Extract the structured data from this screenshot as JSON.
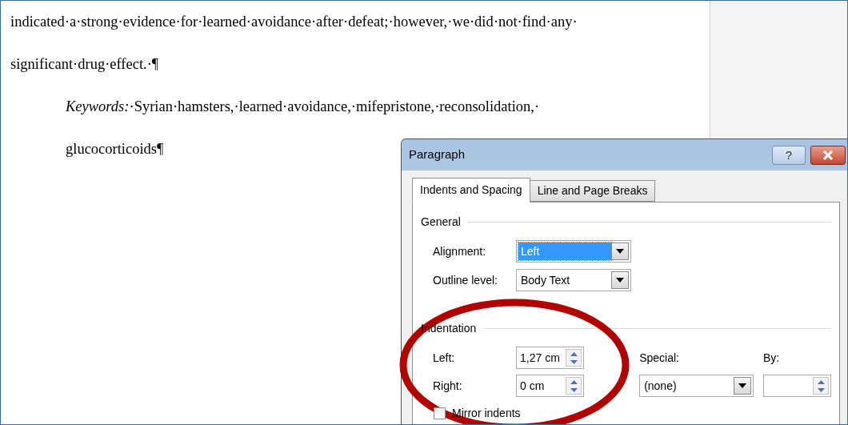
{
  "document": {
    "lines": [
      {
        "kind": "body",
        "text": "indicated·a·strong·evidence·for·learned·avoidance·after·defeat;·however,·we·did·not·find·any·"
      },
      {
        "kind": "body",
        "text": "significant·drug·effect.·¶"
      },
      {
        "kind": "indented",
        "text": "*Keywords:*·Syrian·hamsters,·learned·avoidance,·mifepristone,·reconsolidation,·"
      },
      {
        "kind": "indented",
        "text": "glucocorticoids¶"
      }
    ]
  },
  "dialog": {
    "title": "Paragraph",
    "help_button": "?",
    "tabs": [
      {
        "label": "Indents and Spacing",
        "selected": true
      },
      {
        "label": "Line and Page Breaks",
        "selected": false
      }
    ],
    "general": {
      "title": "General",
      "alignment": {
        "label": "Alignment:",
        "value": "Left",
        "selected": true
      },
      "outline_level": {
        "label": "Outline level:",
        "value": "Body Text",
        "selected": false
      }
    },
    "indentation": {
      "title": "Indentation",
      "left": {
        "label": "Left:",
        "value": "1,27 cm"
      },
      "right": {
        "label": "Right:",
        "value": "0 cm"
      },
      "special": {
        "label": "Special:",
        "value": "(none)"
      },
      "by": {
        "label": "By:"
      },
      "mirror_indents": {
        "label": "Mirror indents",
        "checked": false
      }
    }
  }
}
